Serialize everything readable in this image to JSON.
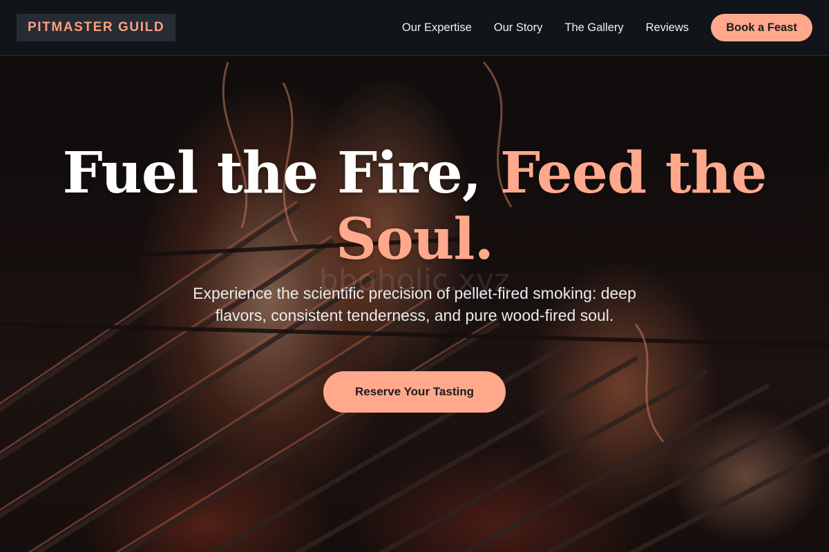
{
  "header": {
    "logo": "PITMASTER GUILD",
    "nav": [
      "Our Expertise",
      "Our Story",
      "The Gallery",
      "Reviews"
    ],
    "cta_label": "Book a Feast"
  },
  "hero": {
    "headline_main": "Fuel the Fire, ",
    "headline_accent": "Feed the Soul.",
    "watermark": "bbqholic.xyz",
    "subtext": "Experience the scientific precision of pellet-fired smoking: deep flavors, consistent tenderness, and pure wood-fired soul.",
    "cta_label": "Reserve Your Tasting",
    "background_image": "grill-fire-photo"
  },
  "colors": {
    "accent": "#ffa88c",
    "header_bg": "#111418",
    "logo_bg": "#252c33"
  }
}
